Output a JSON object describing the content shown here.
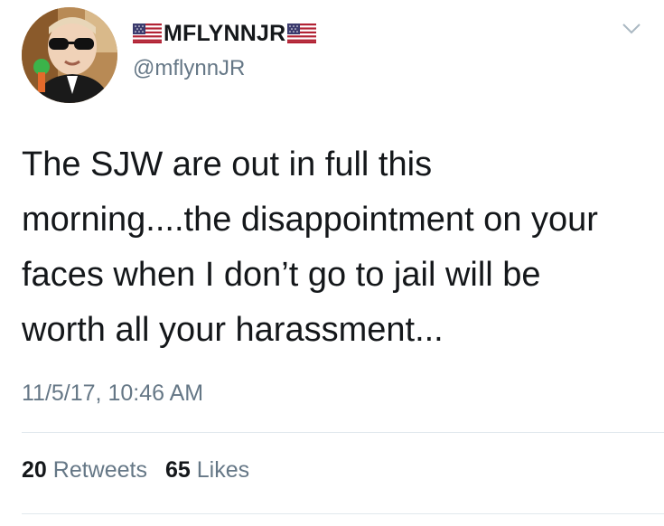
{
  "user": {
    "display_name": "MFLYNNJR",
    "handle": "@mflynnJR"
  },
  "tweet": {
    "text": "The SJW are out in full this\nmorning....the disappointment on your\nfaces when I don’t go to jail will be\nworth all your harassment...",
    "timestamp": "11/5/17, 10:46 AM"
  },
  "stats": {
    "retweets_count": "20",
    "retweets_label": "Retweets",
    "likes_count": "65",
    "likes_label": "Likes"
  },
  "icons": {
    "flag": "us-flag-emoji-icon",
    "menu": "chevron-down-icon"
  },
  "colors": {
    "text_primary": "#14171a",
    "text_secondary": "#657786",
    "divider": "#e1e8ed"
  }
}
